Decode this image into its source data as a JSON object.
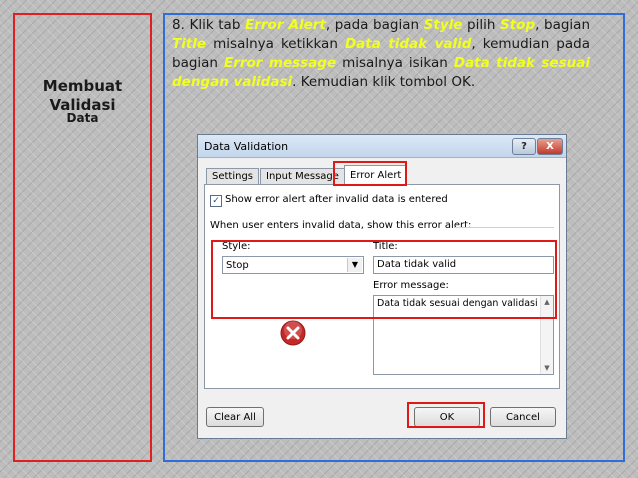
{
  "slide": {
    "left_title_line1": "Membuat",
    "left_title_line2": "Validasi",
    "left_title_line3": "Data",
    "instruction": {
      "p1": "8. Klik tab ",
      "h1": "Error Alert",
      "p2": ", pada bagian ",
      "h2": "Style",
      "p3": " pilih ",
      "h3": "Stop",
      "p4": ", bagian ",
      "h4": "Title",
      "p5": " misalnya ketikkan ",
      "h5": "Data tidak valid",
      "p6": ", kemudian pada bagian ",
      "h6": "Error message",
      "p7": " misalnya isikan ",
      "h7": "Data tidak sesuai dengan validasi",
      "p8": ". Kemudian klik tombol OK."
    }
  },
  "dialog": {
    "title": "Data Validation",
    "help_label": "?",
    "close_label": "X",
    "tabs": [
      "Settings",
      "Input Message",
      "Error Alert"
    ],
    "show_alert_label": "Show error alert after invalid data is entered",
    "section_label": "When user enters invalid data, show this error alert:",
    "style_label": "Style:",
    "style_value": "Stop",
    "title_label": "Title:",
    "title_value": "Data tidak valid",
    "error_message_label": "Error message:",
    "error_message_value": "Data tidak sesuai dengan validasi",
    "clear_all_label": "Clear All",
    "ok_label": "OK",
    "cancel_label": "Cancel"
  },
  "colors": {
    "highlight": "#f2ff1f",
    "red_box": "#e02020",
    "blue_box": "#2f6ed8"
  }
}
